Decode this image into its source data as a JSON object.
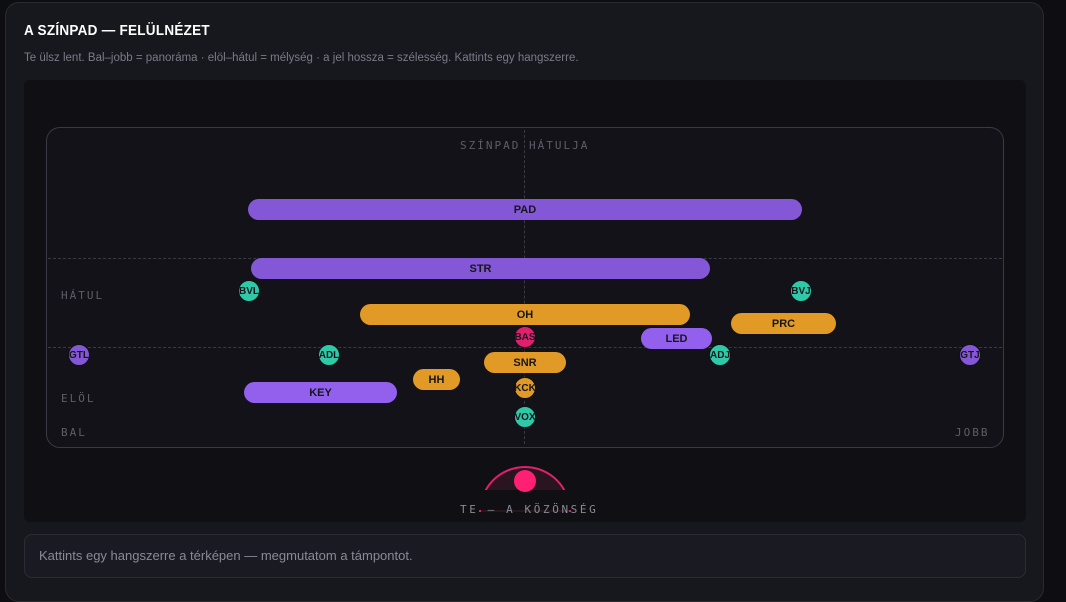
{
  "header": {
    "title": "A SZÍNPAD — FELÜLNÉZET",
    "subtitle": "Te ülsz lent. Bal–jobb = panoráma · elöl–hátul = mélység · a jel hossza = szélesség. Kattints egy hangszerre."
  },
  "stage": {
    "back_label": "SZÍNPAD HÁTULJA",
    "depth_back_label": "HÁTUL",
    "depth_front_label": "ELÖL",
    "left_label": "BAL",
    "right_label": "JOBB"
  },
  "colors": {
    "purple": "#8457d6",
    "purple_light": "#9360ee",
    "orange": "#e29a27",
    "teal": "#2fc9a8",
    "pink": "#e0206f"
  },
  "instruments": {
    "pad": "PAD",
    "str": "STR",
    "oh": "OH",
    "prc": "PRC",
    "led": "LED",
    "bas": "BAS",
    "snr": "SNR",
    "hh": "HH",
    "key": "KEY",
    "kck": "KCK",
    "vox": "VOX",
    "bvl": "BVL",
    "bvj": "BVJ",
    "gtl": "GTL",
    "gtj": "GTJ",
    "adl": "ADL",
    "adj": "ADJ"
  },
  "audience": {
    "label": "TE — A KÖZÖNSÉG"
  },
  "hint": {
    "text": "Kattints egy hangszerre a térképen — megmutatom a támpontot."
  }
}
